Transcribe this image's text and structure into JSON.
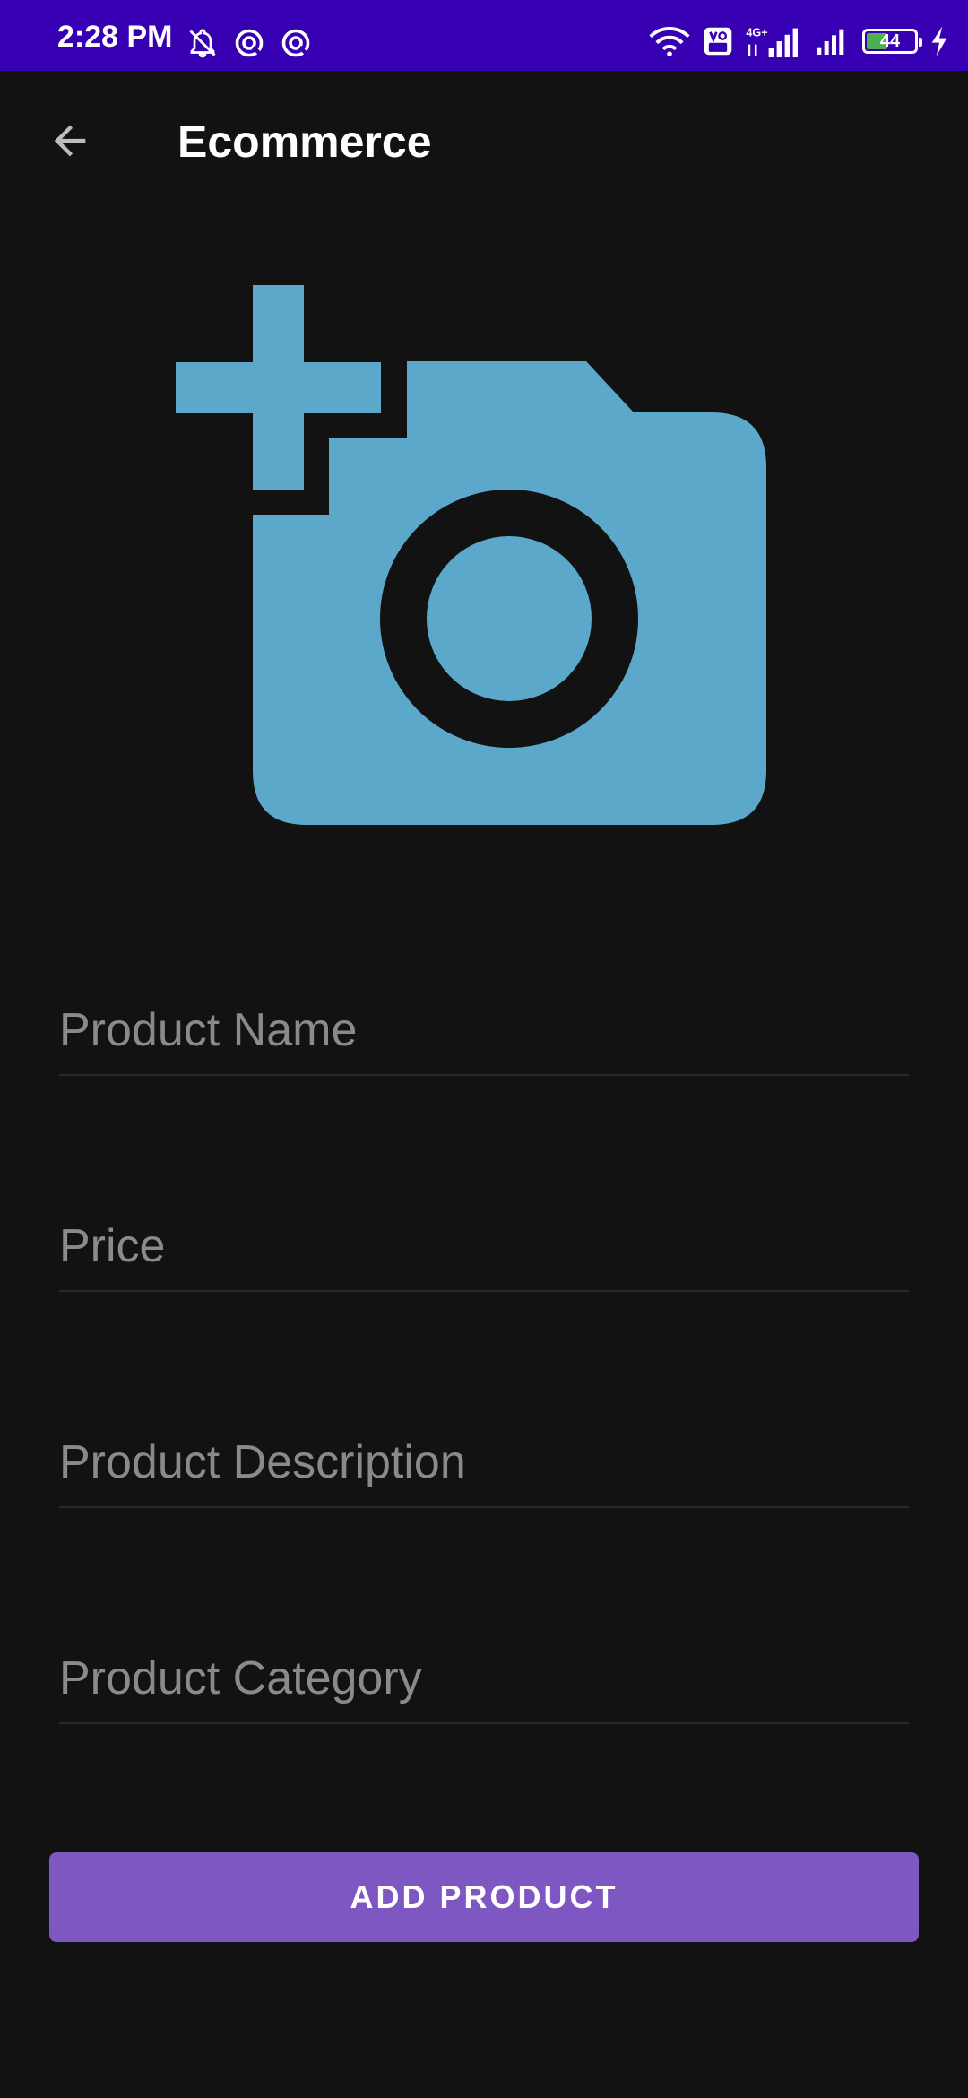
{
  "status_bar": {
    "time": "2:28 PM",
    "battery_level": "44",
    "battery_fraction": 0.44,
    "network_label": "4G+",
    "volte_label": "Vo LTE",
    "icons": [
      "mute-icon",
      "data-saver-icon",
      "data-saver-icon",
      "wifi-icon",
      "volte-icon",
      "signal-icon",
      "signal-icon",
      "battery-icon",
      "charging-icon"
    ]
  },
  "app_bar": {
    "title": "Ecommerce",
    "back_icon": "arrow-back-icon"
  },
  "photo": {
    "icon": "add-a-photo-icon",
    "color": "#5CA8CB"
  },
  "form": {
    "product_name_placeholder": "Product Name",
    "price_placeholder": "Price",
    "description_placeholder": "Product Description",
    "category_placeholder": "Product Category",
    "product_name_value": "",
    "price_value": "",
    "description_value": "",
    "category_value": ""
  },
  "actions": {
    "add_product_label": "ADD PRODUCT",
    "button_color": "#7E57C2"
  },
  "colors": {
    "status_bar": "#3700B3",
    "background": "#121212",
    "placeholder": "#8A8A8A"
  }
}
